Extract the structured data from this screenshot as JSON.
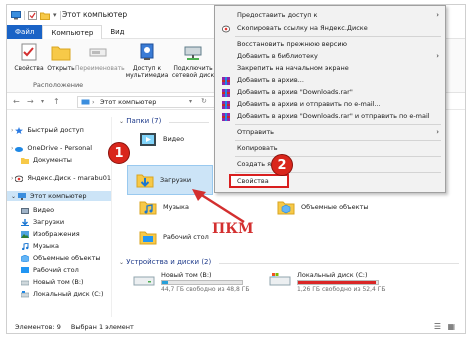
{
  "title": "Этот компьютер",
  "colors": {
    "accent": "#1a63c6",
    "selection": "#cce4f7",
    "annotation": "#d9261c",
    "progress": "#26a0da"
  },
  "tabs": [
    {
      "label": "Файл"
    },
    {
      "label": "Компьютер"
    },
    {
      "label": "Вид"
    }
  ],
  "ribbon": {
    "properties": "Свойства",
    "open": "Открыть",
    "rename": "Переименовать",
    "media_access": "Доступ к мультимедиа",
    "map_drive": "Подключить сетевой диск",
    "add_location": "Добавить сетевое расположение",
    "group_location": "Расположение"
  },
  "address": {
    "path": "Этот компьютер"
  },
  "sidebar": {
    "items": [
      {
        "label": "Быстрый доступ",
        "icon": "star-icon"
      },
      {
        "label": "OneDrive - Personal",
        "icon": "cloud-icon"
      },
      {
        "label": "Документы",
        "icon": "folder-icon"
      },
      {
        "label": "Яндекс.Диск - marabu01",
        "icon": "yandex-disk-icon"
      },
      {
        "label": "Этот компьютер",
        "icon": "computer-icon"
      },
      {
        "label": "Видео",
        "icon": "video-folder-icon"
      },
      {
        "label": "Загрузки",
        "icon": "downloads-folder-icon"
      },
      {
        "label": "Изображения",
        "icon": "pictures-folder-icon"
      },
      {
        "label": "Музыка",
        "icon": "music-folder-icon"
      },
      {
        "label": "Объемные объекты",
        "icon": "3d-objects-icon"
      },
      {
        "label": "Рабочий стол",
        "icon": "desktop-folder-icon"
      },
      {
        "label": "Новый том (B:)",
        "icon": "drive-icon"
      },
      {
        "label": "Локальный диск (C:)",
        "icon": "drive-icon"
      }
    ]
  },
  "content": {
    "folders_header": "Папки (7)",
    "folders": {
      "video": "Видео",
      "downloads": "Загрузки",
      "music": "Музыка",
      "objects": "Объемные объекты",
      "desktop": "Рабочий стол"
    },
    "drives_header": "Устройства и диски (2)",
    "drives": [
      {
        "name": "Новый том (B:)",
        "free": "44,7 ГБ свободно из 48,8 ГБ",
        "used_fraction": 0.08
      },
      {
        "name": "Локальный диск (C:)",
        "free": "1,26 ГБ свободно из 52,4 ГБ",
        "used_fraction": 0.97
      }
    ]
  },
  "status": {
    "count": "Элементов: 9",
    "selected": "Выбран 1 элемент"
  },
  "context_menu": {
    "items": [
      {
        "label": "Предоставить доступ к",
        "submenu": true
      },
      {
        "label": "Скопировать ссылку на Яндекс.Диске",
        "icon": "yandex-disk-icon"
      },
      {
        "label": "Восстановить прежнюю версию"
      },
      {
        "label": "Добавить в библиотеку",
        "submenu": true
      },
      {
        "label": "Закрепить на начальном экране"
      },
      {
        "label": "Добавить в архив...",
        "icon": "winrar-icon"
      },
      {
        "label": "Добавить в архив \"Downloads.rar\"",
        "icon": "winrar-icon"
      },
      {
        "label": "Добавить в архив и отправить по e-mail...",
        "icon": "winrar-icon"
      },
      {
        "label": "Добавить в архив \"Downloads.rar\" и отправить по e-mail",
        "icon": "winrar-icon"
      },
      {
        "label": "Отправить",
        "submenu": true
      },
      {
        "label": "Копировать"
      },
      {
        "label": "Создать ярлык"
      },
      {
        "label": "Свойства"
      }
    ]
  },
  "annotations": {
    "step1": "1",
    "step2": "2",
    "rmb": "ПКМ"
  }
}
